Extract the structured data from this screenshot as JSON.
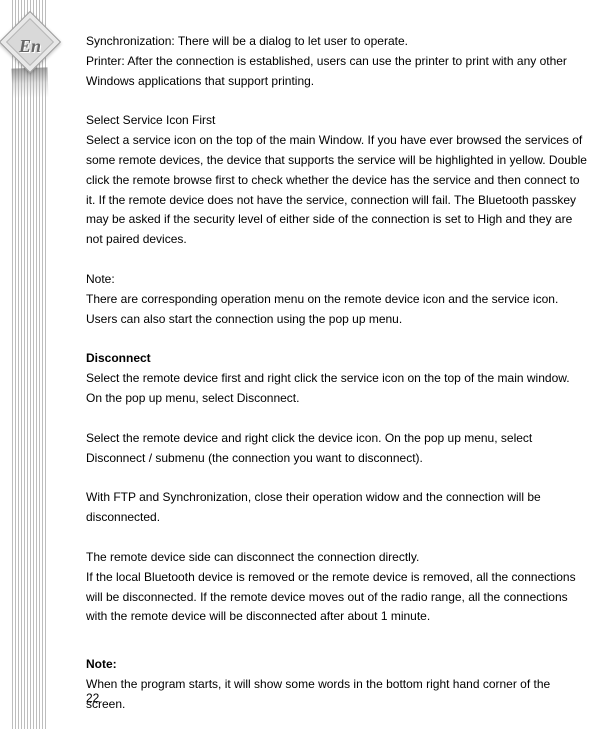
{
  "sidebar": {
    "badge_label": "En"
  },
  "body": {
    "p1": "Synchronization: There will be a dialog to let user to operate.",
    "p2": "Printer: After the connection is established, users can use the printer to print with any other Windows applications that support printing.",
    "h1": "Select Service Icon First",
    "p3": "Select a service icon on the top of the main Window. If you have ever browsed the services of some remote devices, the device that supports the service will be highlighted in yellow. Double click the remote browse first to check whether the device has the service and then connect to it. If the remote device does not have the service, connection will fail. The Bluetooth passkey may be asked if the security level of either side of the connection is set to High and they are not paired devices.",
    "note1_label": "Note:",
    "note1_text": "There are corresponding operation menu on the remote device icon and the service icon. Users can also start the connection using the pop up menu.",
    "h2": "Disconnect",
    "p4": "Select the remote device first and right click the service icon on the top of the main window. On the pop up menu, select Disconnect.",
    "p5": "Select the remote device and right click the device icon. On the pop up menu, select Disconnect / submenu (the connection you want to disconnect).",
    "p6": "With FTP and Synchronization, close their operation widow and the connection will be disconnected.",
    "p7": "The remote device side can disconnect the connection directly.",
    "p8": "If the local Bluetooth device is removed or the remote device is removed, all the connections will be disconnected. If the remote device moves out of the radio range, all the connections with the remote device will be disconnected after about 1 minute.",
    "note2_label": "Note:",
    "note2_text": "When the program starts, it will show some words in the bottom right hand corner of the screen."
  },
  "page_number": "22"
}
